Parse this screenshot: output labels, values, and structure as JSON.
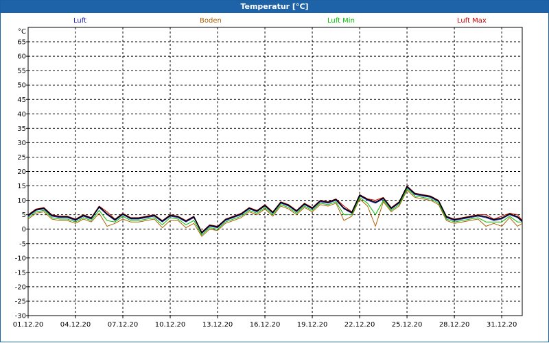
{
  "window": {
    "title": "Temperatur [°C]"
  },
  "chart_data": {
    "type": "line",
    "title": "Temperatur [°C]",
    "ylabel": "°C",
    "xlabel": "",
    "ylim": [
      -30,
      70
    ],
    "yticks": [
      65,
      60,
      55,
      50,
      45,
      40,
      35,
      30,
      25,
      20,
      15,
      10,
      5,
      0,
      -5,
      -10,
      -15,
      -20,
      -25,
      -30
    ],
    "x_tick_labels": [
      "01.12.20",
      "04.12.20",
      "07.12.20",
      "10.12.20",
      "13.12.20",
      "16.12.20",
      "19.12.20",
      "22.12.20",
      "25.12.20",
      "28.12.20",
      "31.12.20"
    ],
    "x_day_range": [
      0,
      31.3
    ],
    "grid": true,
    "legend_placement": "top",
    "x": [
      0,
      0.5,
      1,
      1.5,
      2,
      2.5,
      3,
      3.5,
      4,
      4.5,
      5,
      5.5,
      6,
      6.5,
      7,
      7.5,
      8,
      8.5,
      9,
      9.5,
      10,
      10.5,
      11,
      11.5,
      12,
      12.5,
      13,
      13.5,
      14,
      14.5,
      15,
      15.5,
      16,
      16.5,
      17,
      17.5,
      18,
      18.5,
      19,
      19.5,
      20,
      20.5,
      21,
      21.5,
      22,
      22.5,
      23,
      23.5,
      24,
      24.5,
      25,
      25.5,
      26,
      26.5,
      27,
      27.5,
      28,
      28.5,
      29,
      29.5,
      30,
      30.5,
      31,
      31.3
    ],
    "series": [
      {
        "name": "Luft",
        "color": "#2020c0",
        "values": [
          4.5,
          6.5,
          7,
          4.5,
          4,
          4,
          3,
          4.5,
          3.5,
          7.5,
          5,
          3,
          5,
          3.5,
          3.5,
          4,
          4.5,
          2.5,
          4.5,
          4,
          2.5,
          4,
          -1.5,
          1,
          0.5,
          3,
          4,
          5,
          7,
          6,
          8,
          5.5,
          9,
          8,
          6,
          8.5,
          7,
          9.5,
          9,
          10,
          7,
          5.5,
          11.5,
          10,
          9,
          10.5,
          7,
          9,
          14.5,
          12,
          11.5,
          11,
          9.5,
          4,
          3,
          3.5,
          4,
          4.5,
          4,
          3,
          3.5,
          5,
          4,
          2.5
        ]
      },
      {
        "name": "Boden",
        "color": "#b06000",
        "values": [
          3.5,
          5.5,
          6,
          3.5,
          3,
          3,
          2,
          3.5,
          2.5,
          5.5,
          1,
          2,
          3.5,
          2.5,
          2.5,
          3,
          3.5,
          0.5,
          3,
          3,
          0.5,
          2,
          -2.5,
          0,
          -0.5,
          2,
          3,
          4,
          6,
          5,
          7,
          4.5,
          8,
          7,
          5,
          7.5,
          6,
          8.5,
          8,
          9,
          3,
          4.5,
          10.5,
          8,
          1,
          9.5,
          6,
          8,
          13.5,
          11,
          10.5,
          10,
          8.5,
          3,
          2,
          2.5,
          3,
          3.5,
          1,
          2,
          1,
          4,
          1,
          2
        ]
      },
      {
        "name": "Luft Min",
        "color": "#00c000",
        "values": [
          4,
          6,
          6.5,
          4,
          3.5,
          3.5,
          2.5,
          4,
          3,
          6.5,
          3,
          2.5,
          4.5,
          3,
          3,
          3.5,
          4,
          1.5,
          4,
          3.5,
          1.5,
          3,
          -2,
          0.5,
          0,
          2.5,
          3.5,
          4.5,
          6.5,
          5.5,
          7.5,
          5,
          8.5,
          7.5,
          5.5,
          8,
          6.5,
          9,
          8.5,
          9.5,
          5,
          5,
          11,
          9,
          5,
          10,
          6.5,
          8.5,
          14,
          11.5,
          11,
          10.5,
          9,
          3.5,
          2.5,
          3,
          3.5,
          4,
          2.5,
          2.5,
          2.5,
          4.5,
          2.5,
          2.5
        ]
      },
      {
        "name": "Luft Max",
        "color": "#d00000",
        "values": [
          5,
          7,
          7.5,
          5,
          4.5,
          4.5,
          3.5,
          5,
          4,
          8,
          6,
          3.5,
          5.5,
          4,
          4,
          4.5,
          5,
          3,
          5,
          4.5,
          3,
          4.5,
          -1,
          1.5,
          1,
          3.5,
          4.5,
          5.5,
          7.5,
          6.5,
          8.5,
          6,
          9.5,
          8.5,
          6.5,
          9,
          7.5,
          10,
          9.5,
          10.5,
          8,
          6,
          12,
          10.5,
          10,
          11,
          7.5,
          9.5,
          15,
          12.5,
          12,
          11.5,
          10,
          4.5,
          3.5,
          4,
          4.5,
          5,
          5,
          3.5,
          4.5,
          5.5,
          5,
          3
        ]
      }
    ]
  }
}
